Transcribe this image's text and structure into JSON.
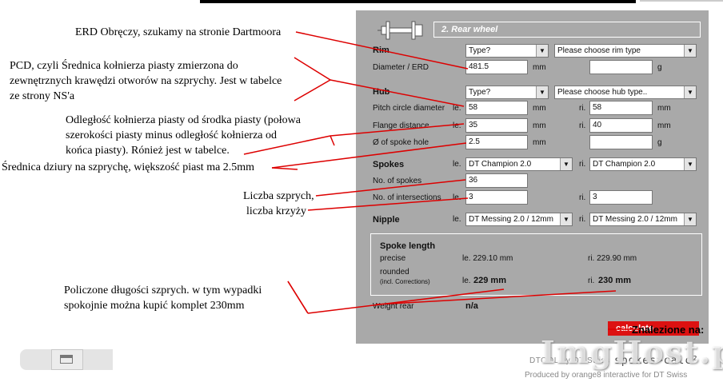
{
  "section": {
    "title": "2. Rear wheel"
  },
  "rim": {
    "label": "Rim",
    "type_select": "Type?",
    "rim_type_select": "Please choose rim type",
    "diameter_label": "Diameter / ERD",
    "diameter_value": "481.5",
    "diameter_unit": "mm",
    "weight_unit": "g"
  },
  "hub": {
    "label": "Hub",
    "type_select": "Type?",
    "hub_type_select": "Please choose hub type..",
    "pcd_label": "Pitch circle diameter",
    "pcd_left_prefix": "le.",
    "pcd_left": "58",
    "pcd_unit_left": "mm",
    "pcd_right_prefix": "ri.",
    "pcd_right": "58",
    "pcd_unit_right": "mm",
    "flange_label": "Flange distance",
    "flange_left_prefix": "le.",
    "flange_left": "35",
    "flange_unit_left": "mm",
    "flange_right_prefix": "ri.",
    "flange_right": "40",
    "flange_unit_right": "mm",
    "hole_label": "Ø of spoke hole",
    "hole_value": "2.5",
    "hole_unit": "mm",
    "weight_unit": "g"
  },
  "spokes": {
    "label": "Spokes",
    "left_prefix": "le.",
    "left_select": "DT Champion 2.0",
    "right_prefix": "ri.",
    "right_select": "DT Champion 2.0",
    "count_label": "No. of spokes",
    "count_value": "36",
    "cross_label": "No. of intersections",
    "cross_left_prefix": "le.",
    "cross_left": "3",
    "cross_right_prefix": "ri.",
    "cross_right": "3"
  },
  "nipple": {
    "label": "Nipple",
    "left_prefix": "le.",
    "left_select": "DT Messing 2.0 / 12mm",
    "right_prefix": "ri.",
    "right_select": "DT Messing 2.0 / 12mm"
  },
  "result": {
    "title": "Spoke length",
    "precise_label": "precise",
    "precise_left": "le. 229.10 mm",
    "precise_right": "ri. 229.90 mm",
    "rounded_label": "rounded",
    "rounded_note": "(incl. Corrections)",
    "rounded_left_prefix": "le.",
    "rounded_left": "229 mm",
    "rounded_right_prefix": "ri.",
    "rounded_right": "230 mm",
    "weight_label": "Weight rear",
    "weight_value": "n/a"
  },
  "calculate_label": "calculate",
  "found_label": "Znalezione na:",
  "footer": {
    "dtool": "DTOOL by DT Swiss",
    "logo": "spokes>calc²",
    "produced": "Produced by orange8 interactive for DT Swiss",
    "watermark": "ImgHost.pl"
  },
  "annotations": {
    "erd": "ERD Obręczy, szukamy na stronie Dartmoora",
    "pcd": [
      "PCD, czyli Średnica kołnierza piasty zmierzona do",
      "zewnętrznych krawędzi otworów na szprychy. Jest w tabelce",
      "ze strony NS'a"
    ],
    "flange": [
      "Odległość kołnierza piasty od środka piasty (połowa",
      "szerokości piasty minus odległość kołnierza od",
      "końca piasty). Rónież jest w tabelce."
    ],
    "hole": "Średnica dziury na szprychę, większość piast ma 2.5mm",
    "count": [
      "Liczba szprych,",
      "liczba krzyży"
    ],
    "result": [
      "Policzone długości szprych. w tym wypadki",
      "spokojnie można kupić komplet 230mm"
    ]
  },
  "colors": {
    "panel": "#a9a9a9",
    "accent": "#dd1111",
    "annotation_line": "#dd0000"
  }
}
